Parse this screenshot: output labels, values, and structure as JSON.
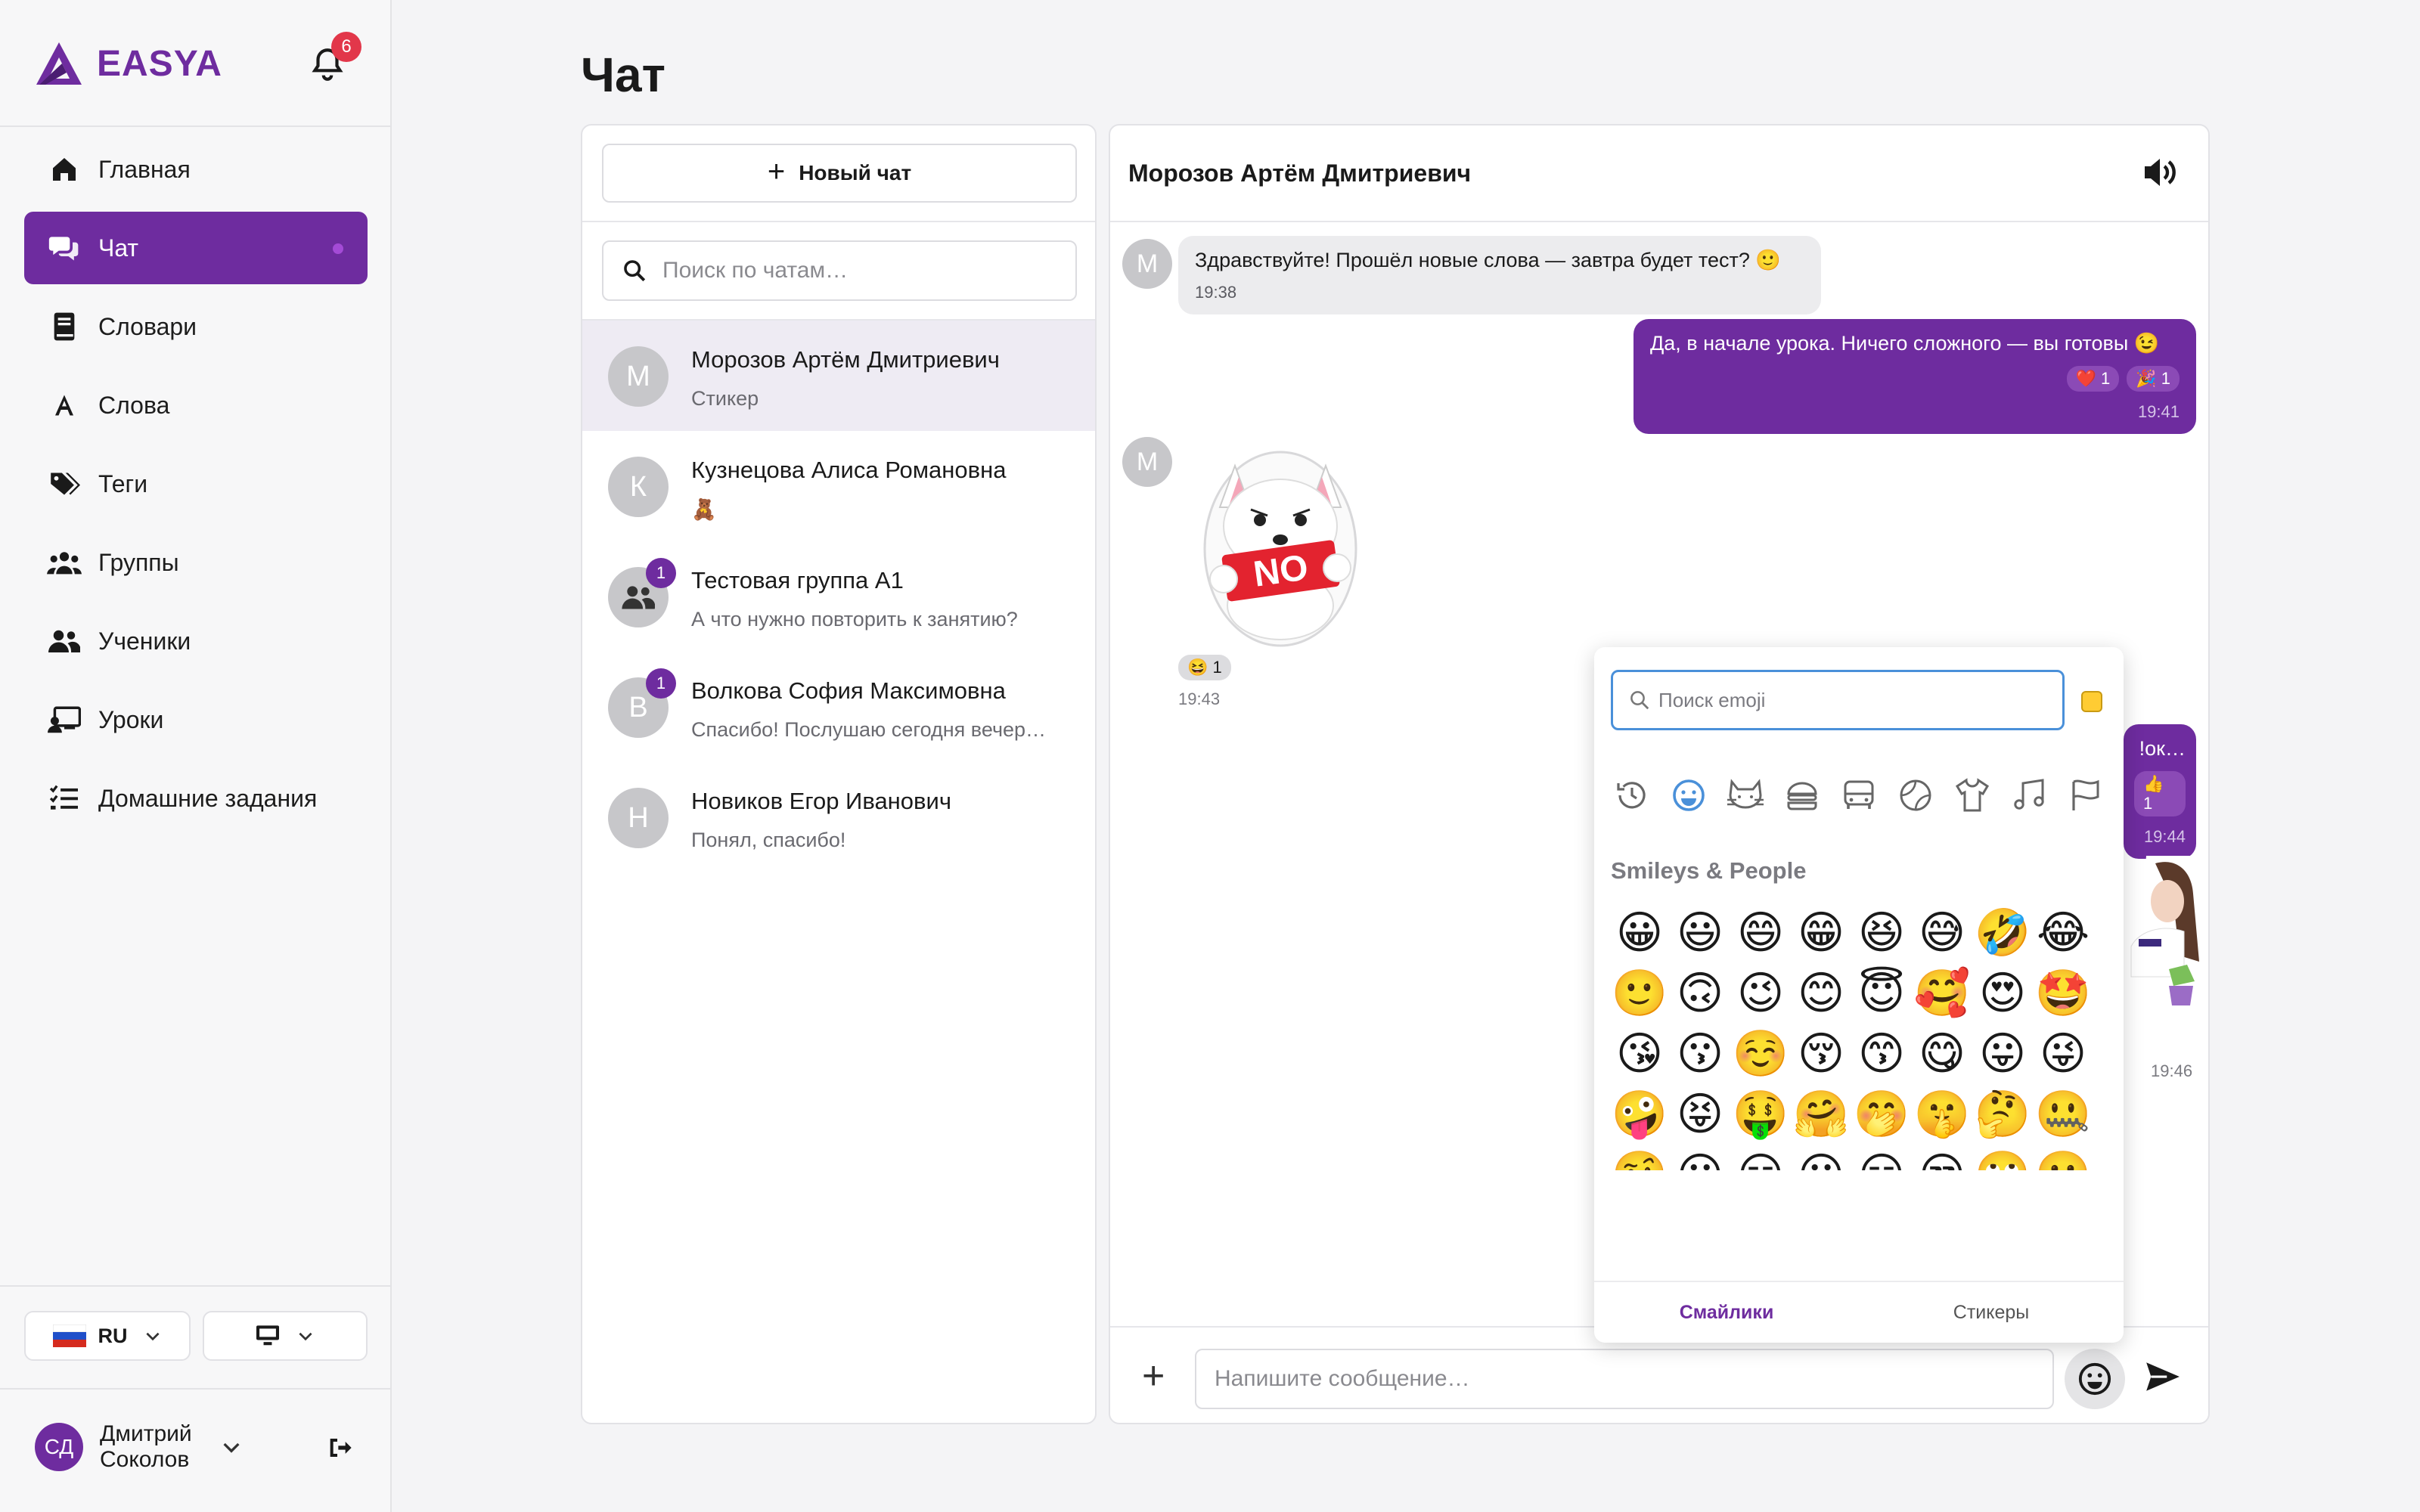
{
  "app": {
    "name": "EASYA",
    "notifications_count": "6"
  },
  "nav": [
    {
      "label": "Главная",
      "icon": "home-icon"
    },
    {
      "label": "Чат",
      "icon": "chat-icon",
      "active": true
    },
    {
      "label": "Словари",
      "icon": "book-icon"
    },
    {
      "label": "Слова",
      "icon": "letter-a-icon"
    },
    {
      "label": "Теги",
      "icon": "tags-icon"
    },
    {
      "label": "Группы",
      "icon": "groups-icon"
    },
    {
      "label": "Ученики",
      "icon": "students-icon"
    },
    {
      "label": "Уроки",
      "icon": "lessons-icon"
    },
    {
      "label": "Домашние задания",
      "icon": "homework-icon"
    }
  ],
  "footer": {
    "language": "RU",
    "user_initials": "СД",
    "user_name_line1": "Дмитрий",
    "user_name_line2": "Соколов"
  },
  "page": {
    "title": "Чат"
  },
  "chat_list": {
    "new_chat_label": "Новый чат",
    "search_placeholder": "Поиск по чатам…",
    "items": [
      {
        "initial": "М",
        "name": "Морозов Артём Дмитриевич",
        "last": "Стикер",
        "selected": true
      },
      {
        "initial": "К",
        "name": "Кузнецова Алиса Романовна",
        "last": "🧸"
      },
      {
        "initial": "",
        "name": "Тестовая группа A1",
        "last": "А что нужно повторить к занятию?",
        "badge": "1",
        "group": true
      },
      {
        "initial": "В",
        "name": "Волкова София Максимовна",
        "last": "Спасибо! Послушаю сегодня вечер…",
        "badge": "1"
      },
      {
        "initial": "Н",
        "name": "Новиков Егор Иванович",
        "last": "Понял, спасибо!"
      }
    ]
  },
  "conversation": {
    "title": "Морозов Артём Дмитриевич",
    "messages": [
      {
        "text": "Здравствуйте! Прошёл новые слова — завтра будет тест? 🙂",
        "time": "19:38"
      },
      {
        "text": "Да, в начале урока. Ничего сложного — вы готовы 😉",
        "time": "19:41",
        "reactions": [
          "❤️ 1",
          "🎉 1"
        ]
      },
      {
        "sticker_text": "NO",
        "reaction": "😆 1",
        "time": "19:43"
      },
      {
        "text": "…ок! 😄",
        "reaction": "👍 1",
        "time": "19:44"
      },
      {
        "time": "19:46"
      }
    ],
    "composer_placeholder": "Напишите сообщение…"
  },
  "emoji_picker": {
    "search_placeholder": "Поиск emoji",
    "category_label": "Smileys & People",
    "categories": [
      "recent-icon",
      "smileys-icon",
      "animals-icon",
      "food-icon",
      "travel-icon",
      "activities-icon",
      "objects-icon",
      "symbols-icon",
      "flags-icon"
    ],
    "emojis": [
      "😀",
      "😃",
      "😄",
      "😁",
      "😆",
      "😅",
      "🤣",
      "😂",
      "🙂",
      "🙃",
      "😉",
      "😊",
      "😇",
      "🥰",
      "😍",
      "🤩",
      "😘",
      "😗",
      "☺️",
      "😚",
      "😙",
      "😋",
      "😛",
      "😜",
      "🤪",
      "😝",
      "🤑",
      "🤗",
      "🤭",
      "🤫",
      "🤔",
      "🤐",
      "🤨",
      "😐",
      "😑",
      "😶",
      "😏",
      "😒",
      "🙄",
      "😬",
      "🤥",
      "😌",
      "😔",
      "😪",
      "🤤",
      "😴",
      "😷",
      "🤒",
      "🤕",
      "🤢",
      "🤮",
      "🤧",
      "🥵",
      "🥶",
      "🥴",
      "😵"
    ],
    "tabs": [
      "Смайлики",
      "Стикеры"
    ]
  },
  "colors": {
    "accent": "#6e2c9f",
    "badge_red": "#e2374a"
  }
}
